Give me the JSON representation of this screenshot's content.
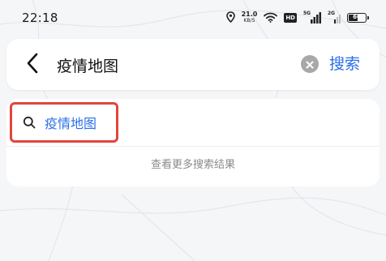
{
  "status_bar": {
    "time": "22:18",
    "net_speed_value": "21.0",
    "net_speed_unit": "KB/S",
    "hd_label": "HD",
    "sim1_label": "5G",
    "sim2_label": "2G",
    "battery_level": "60",
    "icons": [
      "location-icon",
      "wifi-icon",
      "hd-badge",
      "signal-icon",
      "signal-icon",
      "battery-icon"
    ]
  },
  "search": {
    "query": "疫情地图",
    "back_icon": "chevron-left-icon",
    "clear_icon": "clear-circle-icon",
    "submit_label": "搜索"
  },
  "results": {
    "suggestions": [
      {
        "icon": "search-icon",
        "label": "疫情地图",
        "highlighted": true
      }
    ],
    "more_label": "查看更多搜索结果"
  },
  "colors": {
    "accent": "#2b6fe8",
    "highlight_border": "#e4443c",
    "background": "#f5f6f8"
  }
}
